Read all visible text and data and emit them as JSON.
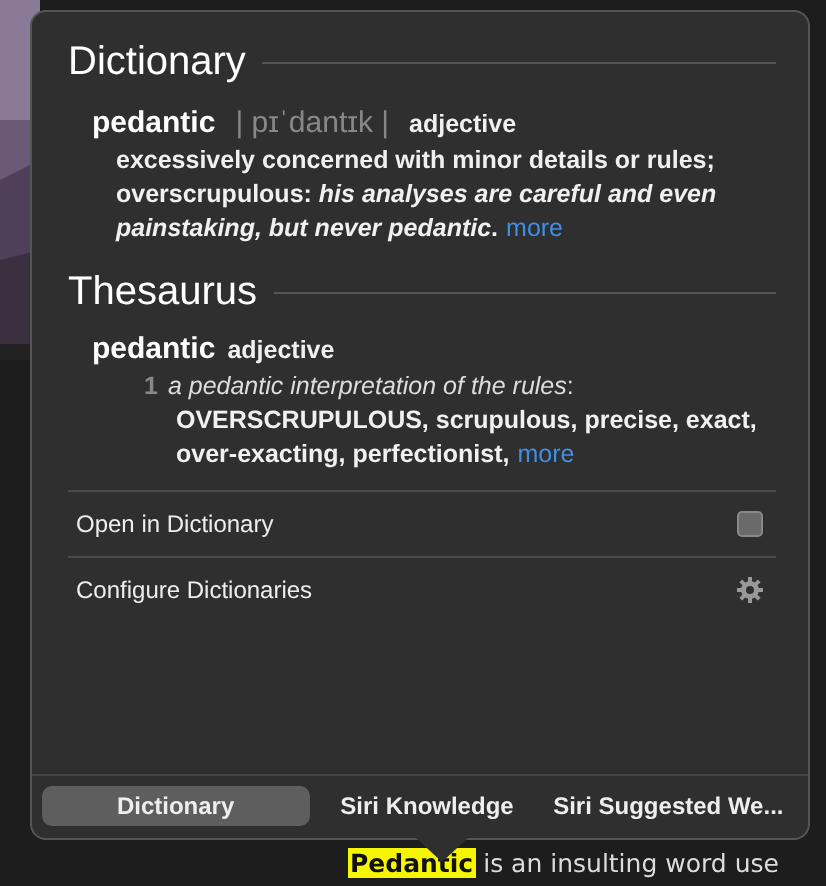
{
  "dictionary": {
    "title": "Dictionary",
    "headword": "pedantic",
    "pronunciation": "| pɪˈdantɪk |",
    "part_of_speech": "adjective",
    "definition": "excessively concerned with minor details or rules; overscrupulous: *his analyses are careful and even painstaking, but never pedantic*.",
    "more": "more"
  },
  "thesaurus": {
    "title": "Thesaurus",
    "headword": "pedantic",
    "part_of_speech": "adjective",
    "sense_number": "1",
    "example": "*a pedantic interpretation of the rules*:",
    "synonyms": "OVERSCRUPULOUS, scrupulous, precise, exact, over-exacting, perfectionist,",
    "more": "more"
  },
  "actions": [
    {
      "kind": "dictionary",
      "label": "Open in Dictionary"
    },
    {
      "kind": "settings",
      "label": "Configure Dictionaries"
    }
  ],
  "tabs": [
    {
      "label": "Dictionary",
      "selected": true
    },
    {
      "label": "Siri Knowledge",
      "selected": false
    },
    {
      "label": "Siri Suggested We...",
      "selected": false
    }
  ],
  "document": {
    "highlight": "Pedantic",
    "text": "is an insulting word use"
  }
}
